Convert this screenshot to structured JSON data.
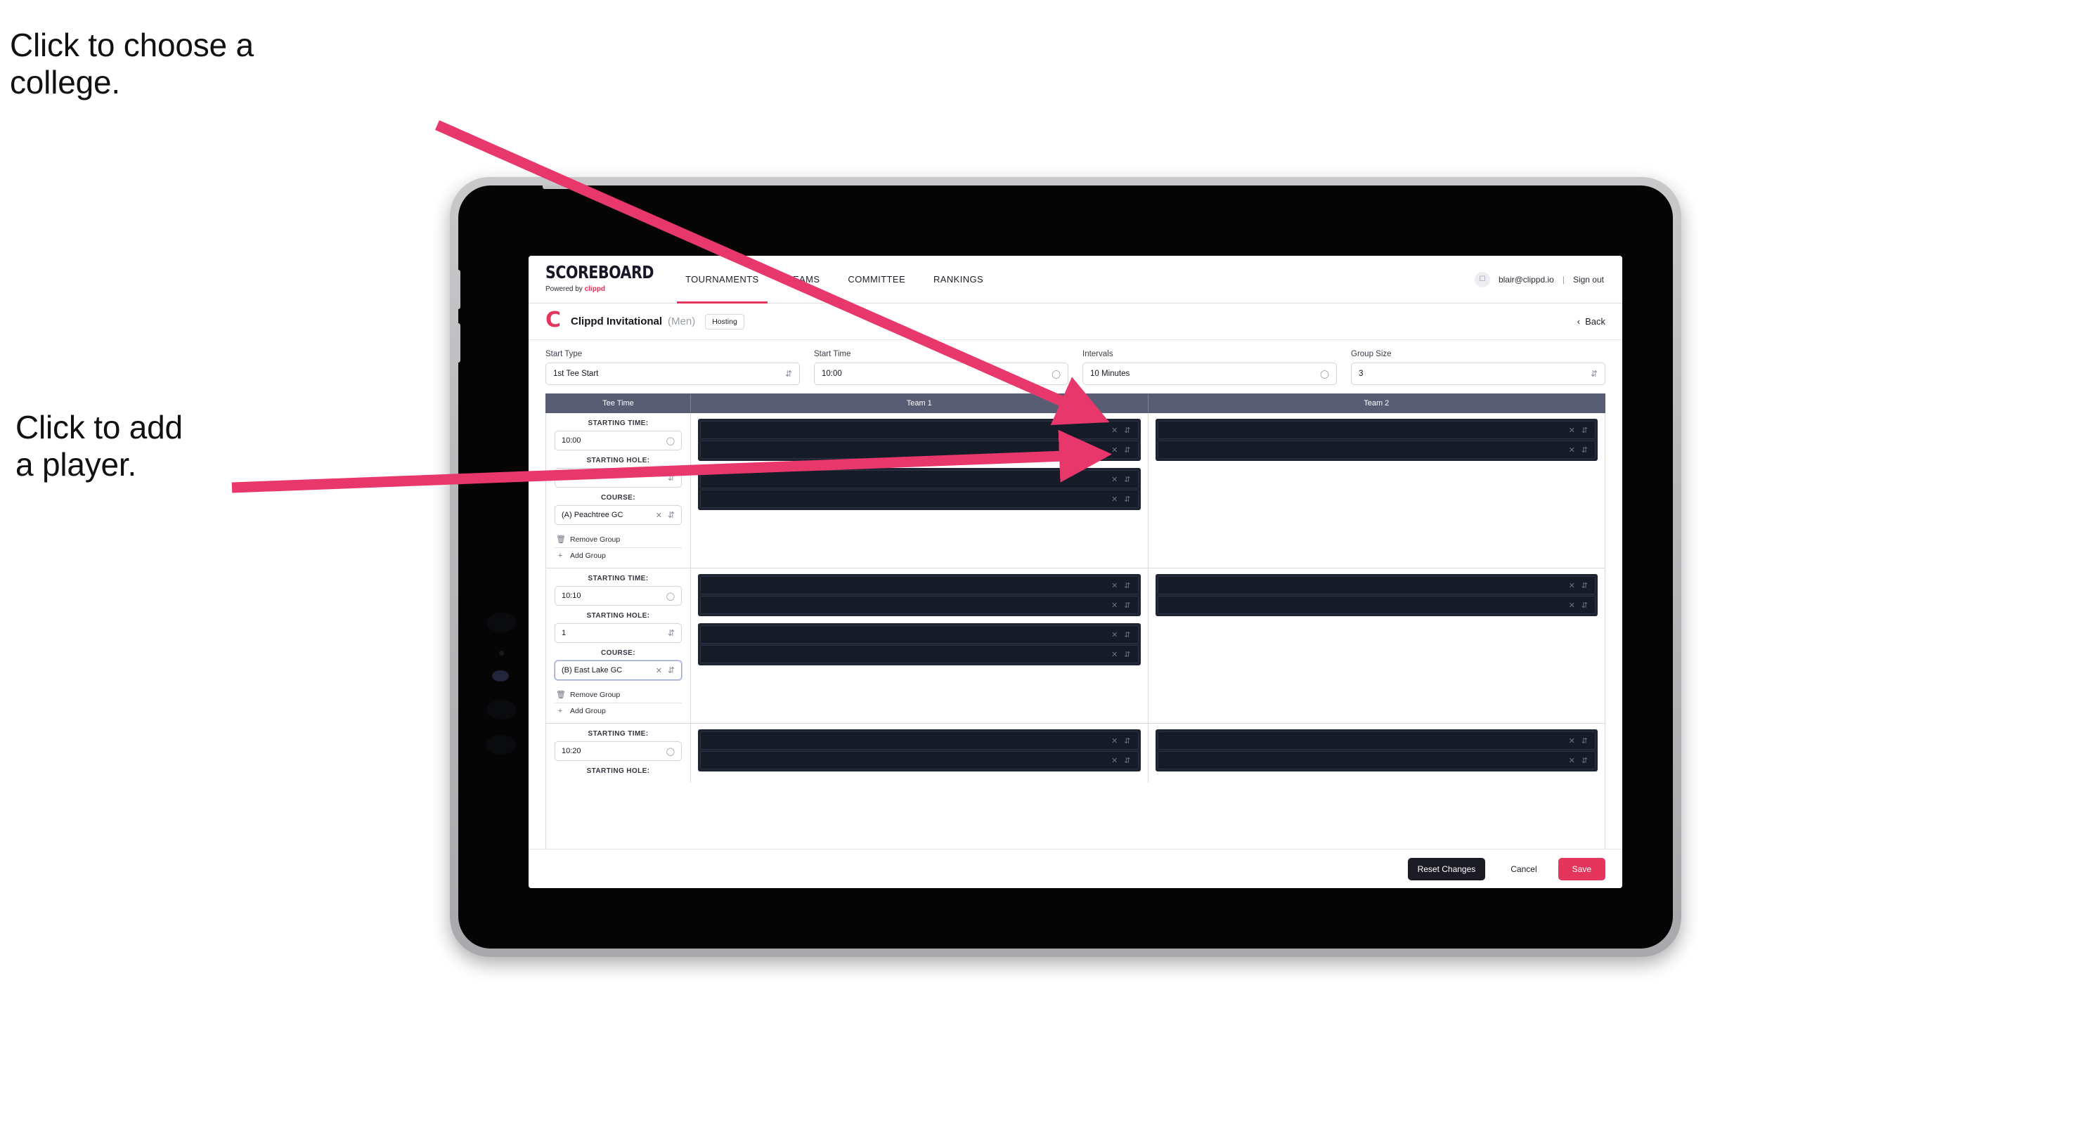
{
  "annotations": {
    "choose_college": "Click to choose a\ncollege.",
    "add_player": "Click to add\na player.",
    "arrow_color": "#e8376b"
  },
  "nav": {
    "brand_title": "SCOREBOARD",
    "brand_sub_prefix": "Powered by ",
    "brand_sub_name": "clippd",
    "tabs": [
      {
        "label": "TOURNAMENTS",
        "active": true
      },
      {
        "label": "TEAMS",
        "active": false
      },
      {
        "label": "COMMITTEE",
        "active": false
      },
      {
        "label": "RANKINGS",
        "active": false
      }
    ],
    "avatar_icon": "user-icon",
    "email": "blair@clippd.io",
    "separator": "|",
    "sign_out": "Sign out"
  },
  "titlebar": {
    "logo_letter": "C",
    "tournament": "Clippd Invitational",
    "gender": "(Men)",
    "badge": "Hosting",
    "back_label": "Back",
    "back_chevron": "‹"
  },
  "controls": [
    {
      "label": "Start Type",
      "value": "1st Tee Start",
      "control": "select"
    },
    {
      "label": "Start Time",
      "value": "10:00",
      "control": "time"
    },
    {
      "label": "Intervals",
      "value": "10 Minutes",
      "control": "time"
    },
    {
      "label": "Group Size",
      "value": "3",
      "control": "select"
    }
  ],
  "table": {
    "headers": {
      "tee": "Tee Time",
      "team1": "Team 1",
      "team2": "Team 2"
    },
    "field_labels": {
      "starting_time": "STARTING TIME:",
      "starting_hole": "STARTING HOLE:",
      "course": "COURSE:"
    },
    "group_actions": {
      "remove": "Remove Group",
      "add": "Add Group",
      "remove_icon": "trash-icon",
      "add_icon": "plus-icon"
    },
    "rows": [
      {
        "starting_time": "10:00",
        "starting_hole": "1",
        "course": "(A) Peachtree GC",
        "course_focused": false,
        "team1_groups": [
          {
            "players": [
              "",
              ""
            ]
          },
          {
            "players": [
              "",
              ""
            ]
          }
        ],
        "team2_groups": [
          {
            "players": [
              "",
              ""
            ]
          }
        ]
      },
      {
        "starting_time": "10:10",
        "starting_hole": "1",
        "course": "(B) East Lake GC",
        "course_focused": true,
        "team1_groups": [
          {
            "players": [
              "",
              ""
            ]
          },
          {
            "players": [
              "",
              ""
            ]
          }
        ],
        "team2_groups": [
          {
            "players": [
              "",
              ""
            ]
          }
        ]
      },
      {
        "starting_time": "10:20",
        "starting_hole": "",
        "course": "",
        "course_focused": false,
        "team1_groups": [
          {
            "players": [
              "",
              ""
            ]
          }
        ],
        "team2_groups": [
          {
            "players": [
              "",
              ""
            ]
          }
        ]
      }
    ]
  },
  "footer": {
    "reset": "Reset Changes",
    "cancel": "Cancel",
    "save": "Save"
  },
  "colors": {
    "accent_pink": "#e4355c",
    "header_slate": "#585d73",
    "player_slot_dark": "#161b28",
    "dark_button": "#1b1b24"
  }
}
